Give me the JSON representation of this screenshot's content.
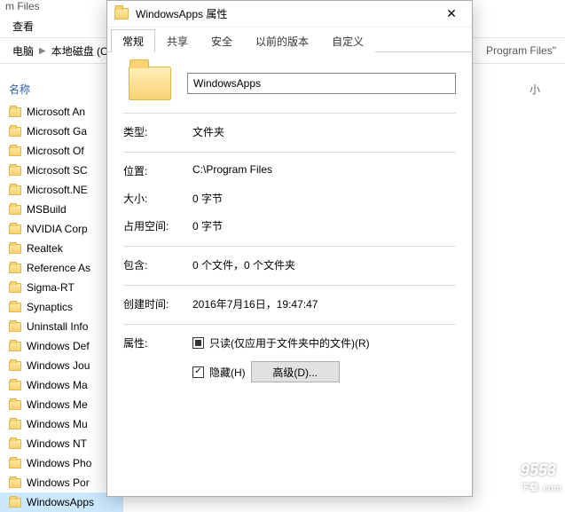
{
  "explorer": {
    "window_title_fragment": "m Files",
    "menu_view": "查看",
    "breadcrumb": {
      "pc": "电脑",
      "disk": "本地磁盘 (C",
      "right_fragment": "Program Files\""
    },
    "column_header_name": "名称",
    "files": [
      "Microsoft An",
      "Microsoft Ga",
      "Microsoft Of",
      "Microsoft SC",
      "Microsoft.NE",
      "MSBuild",
      "NVIDIA Corp",
      "Realtek",
      "Reference As",
      "Sigma-RT",
      "Synaptics",
      "Uninstall Info",
      "Windows Def",
      "Windows Jou",
      "Windows Ma",
      "Windows Me",
      "Windows Mu",
      "Windows NT",
      "Windows Pho",
      "Windows Por",
      "WindowsApps"
    ],
    "selected_index": 20
  },
  "dialog": {
    "title": "WindowsApps 属性",
    "tabs": {
      "general": "常规",
      "sharing": "共享",
      "security": "安全",
      "previous": "以前的版本",
      "custom": "自定义"
    },
    "name_value": "WindowsApps",
    "rows": {
      "type_label": "类型:",
      "type_val": "文件夹",
      "location_label": "位置:",
      "location_val": "C:\\Program Files",
      "size_label": "大小:",
      "size_val": "0 字节",
      "sizeondisk_label": "占用空间:",
      "sizeondisk_val": "0 字节",
      "contains_label": "包含:",
      "contains_val": "0 个文件，0 个文件夹",
      "created_label": "创建时间:",
      "created_val": "2016年7月16日，19:47:47",
      "attr_label": "属性:",
      "readonly_label": "只读(仅应用于文件夹中的文件)(R)",
      "hidden_label": "隐藏(H)",
      "advanced_btn": "高级(D)..."
    },
    "close_glyph": "✕"
  },
  "annotation_small": "小",
  "watermark": {
    "big": "9553",
    "small": "下载 .com"
  }
}
